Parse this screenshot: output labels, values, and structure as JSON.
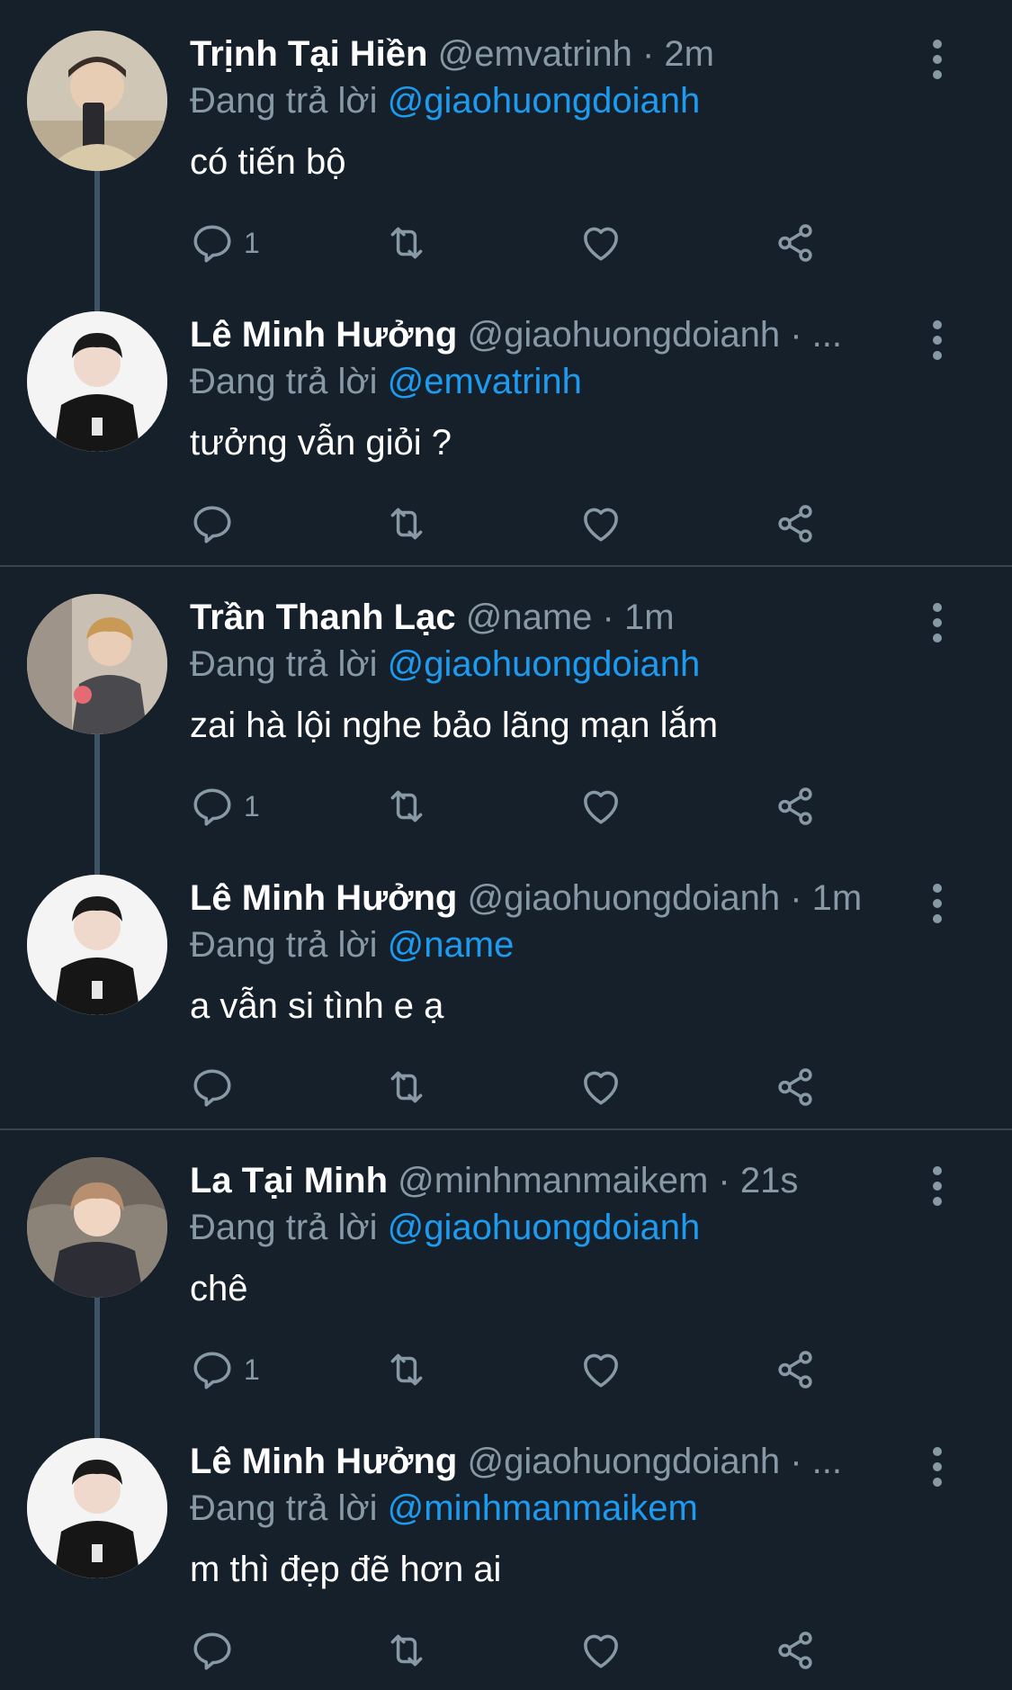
{
  "replying_prefix": "Đang trả lời",
  "threads": [
    {
      "tweets": [
        {
          "name": "Trịnh Tại Hiền",
          "handle": "@emvatrinh",
          "time": "· 2m",
          "reply_to": "@giaohuongdoianh",
          "text": "có tiến bộ",
          "reply_count": "1"
        },
        {
          "name": "Lê Minh Hưởng",
          "handle": "@giaohuongdoianh",
          "time": "· ...",
          "reply_to": "@emvatrinh",
          "text": "tưởng vẫn giỏi ?",
          "reply_count": ""
        }
      ]
    },
    {
      "tweets": [
        {
          "name": "Trần Thanh Lạc",
          "handle": "@name",
          "time": "· 1m",
          "reply_to": "@giaohuongdoianh",
          "text": "zai hà lội nghe bảo lãng mạn lắm",
          "reply_count": "1"
        },
        {
          "name": "Lê Minh Hưởng",
          "handle": "@giaohuongdoianh",
          "time": "· 1m",
          "reply_to": "@name",
          "text": "a vẫn si tình e ạ",
          "reply_count": ""
        }
      ]
    },
    {
      "tweets": [
        {
          "name": "La Tại Minh",
          "handle": "@minhmanmaikem",
          "time": "· 21s",
          "reply_to": "@giaohuongdoianh",
          "text": "chê",
          "reply_count": "1"
        },
        {
          "name": "Lê Minh Hưởng",
          "handle": "@giaohuongdoianh",
          "time": "· ...",
          "reply_to": "@minhmanmaikem",
          "text": "m thì đẹp đẽ hơn ai",
          "reply_count": ""
        }
      ]
    }
  ],
  "colors": {
    "background": "#15202b",
    "secondary_text": "#8899a6",
    "accent": "#1d9bf0",
    "divider": "#38444d"
  },
  "icons": [
    "reply-icon",
    "retweet-icon",
    "like-icon",
    "share-icon",
    "more-icon"
  ]
}
